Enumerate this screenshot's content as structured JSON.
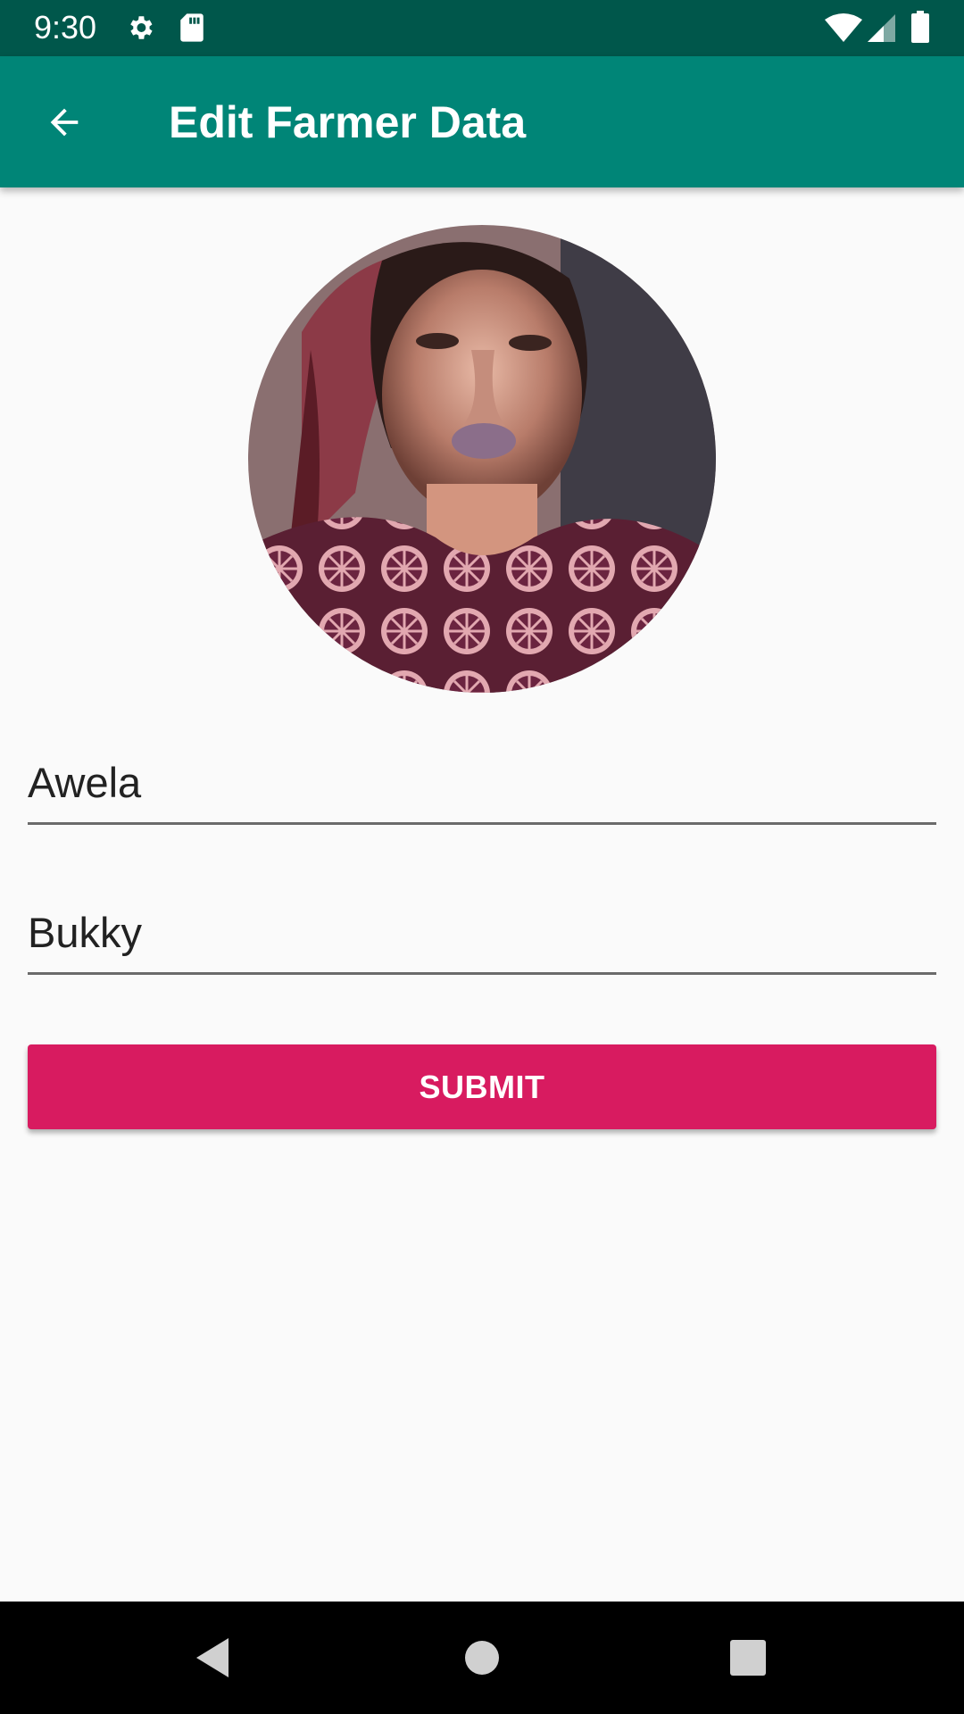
{
  "status_bar": {
    "time": "9:30",
    "icons": [
      "gear-icon",
      "sd-card-icon",
      "wifi-icon",
      "signal-icon",
      "battery-icon"
    ],
    "background": "#00574b"
  },
  "app_bar": {
    "title": "Edit Farmer Data",
    "back_icon": "arrow-back-icon",
    "background": "#008577"
  },
  "profile": {
    "avatar_icon": "farmer-photo"
  },
  "form": {
    "first_name_value": "Awela",
    "last_name_value": "Bukky",
    "submit_label": "SUBMIT",
    "submit_color": "#d81b60"
  },
  "nav_bar": {
    "buttons": [
      "back-triangle-icon",
      "home-circle-icon",
      "recents-square-icon"
    ]
  }
}
